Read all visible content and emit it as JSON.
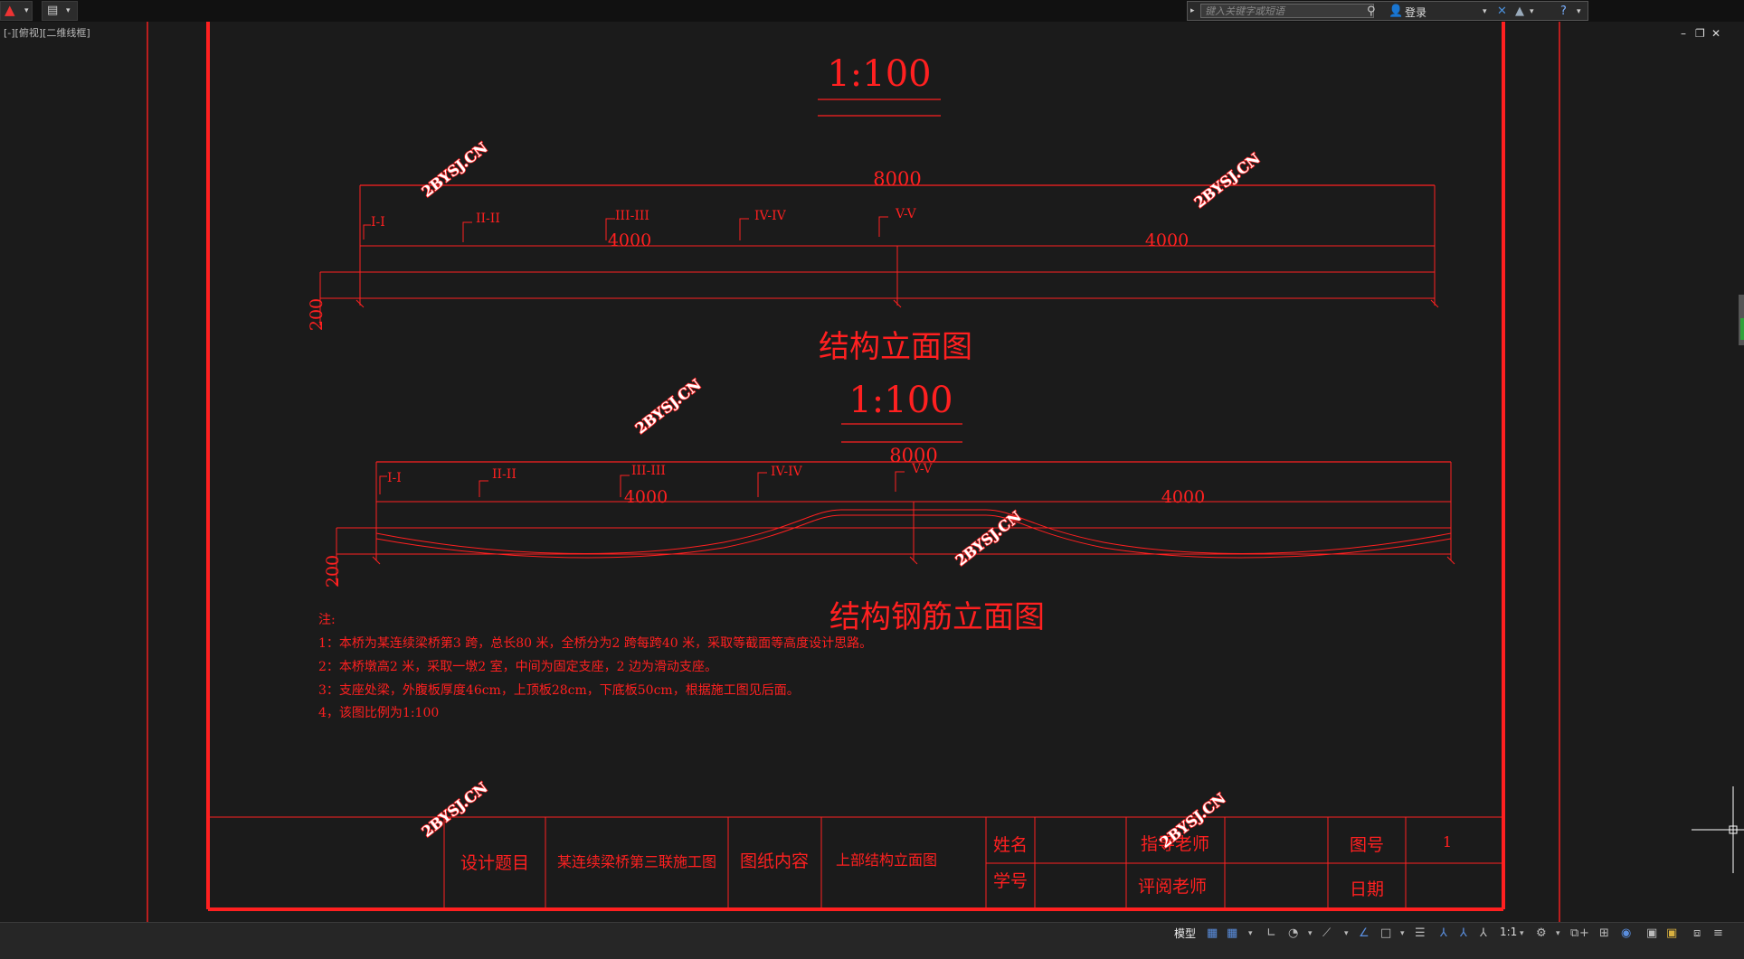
{
  "app": {
    "viewport_label": "[-][俯视][二维线框]",
    "search_placeholder": "键入关键字或短语",
    "login_label": "登录",
    "status_model": "模型",
    "status_scale": "1:1"
  },
  "drawing": {
    "scale_top": "1:100",
    "scale_mid": "1:100",
    "elevation": {
      "total_dim": "8000",
      "left_dim": "4000",
      "right_dim": "4000",
      "height_dim": "200",
      "sections": [
        "I-I",
        "II-II",
        "III-III",
        "IV-IV",
        "V-V"
      ],
      "title": "结构立面图"
    },
    "rebar": {
      "total_dim": "8000",
      "left_dim": "4000",
      "right_dim": "4000",
      "height_dim": "200",
      "sections": [
        "I-I",
        "II-II",
        "III-III",
        "IV-IV",
        "V-V"
      ],
      "title": "结构钢筋立面图"
    },
    "notes_heading": "注:",
    "notes": [
      "1：本桥为某连续梁桥第3 跨，总长80 米，全桥分为2 跨每跨40 米，采取等截面等高度设计思路。",
      "2：本桥墩高2 米，采取一墩2 室，中间为固定支座，2 边为滑动支座。",
      "3：支座处梁，外腹板厚度46cm，上顶板28cm，下底板50cm，根据施工图见后面。",
      "4，该图比例为1:100"
    ],
    "watermarks": [
      "2BYSJ.CN",
      "2BYSJ.CN",
      "2BYSJ.CN",
      "2BYSJ.CN",
      "2BYSJ.CN",
      "2BYSJ.CN"
    ],
    "title_block": {
      "design_topic_label": "设计题目",
      "design_topic_value": "某连续梁桥第三联施工图",
      "content_label": "图纸内容",
      "content_value": "上部结构立面图",
      "name_label": "姓名",
      "student_id_label": "学号",
      "advisor_label": "指导老师",
      "reviewer_label": "评阅老师",
      "drawing_no_label": "图号",
      "drawing_no_value": "1",
      "date_label": "日期"
    }
  },
  "colors": {
    "drawing_red": "#ff2020",
    "watermark": "#ffffff",
    "background": "#1b1b1b"
  }
}
